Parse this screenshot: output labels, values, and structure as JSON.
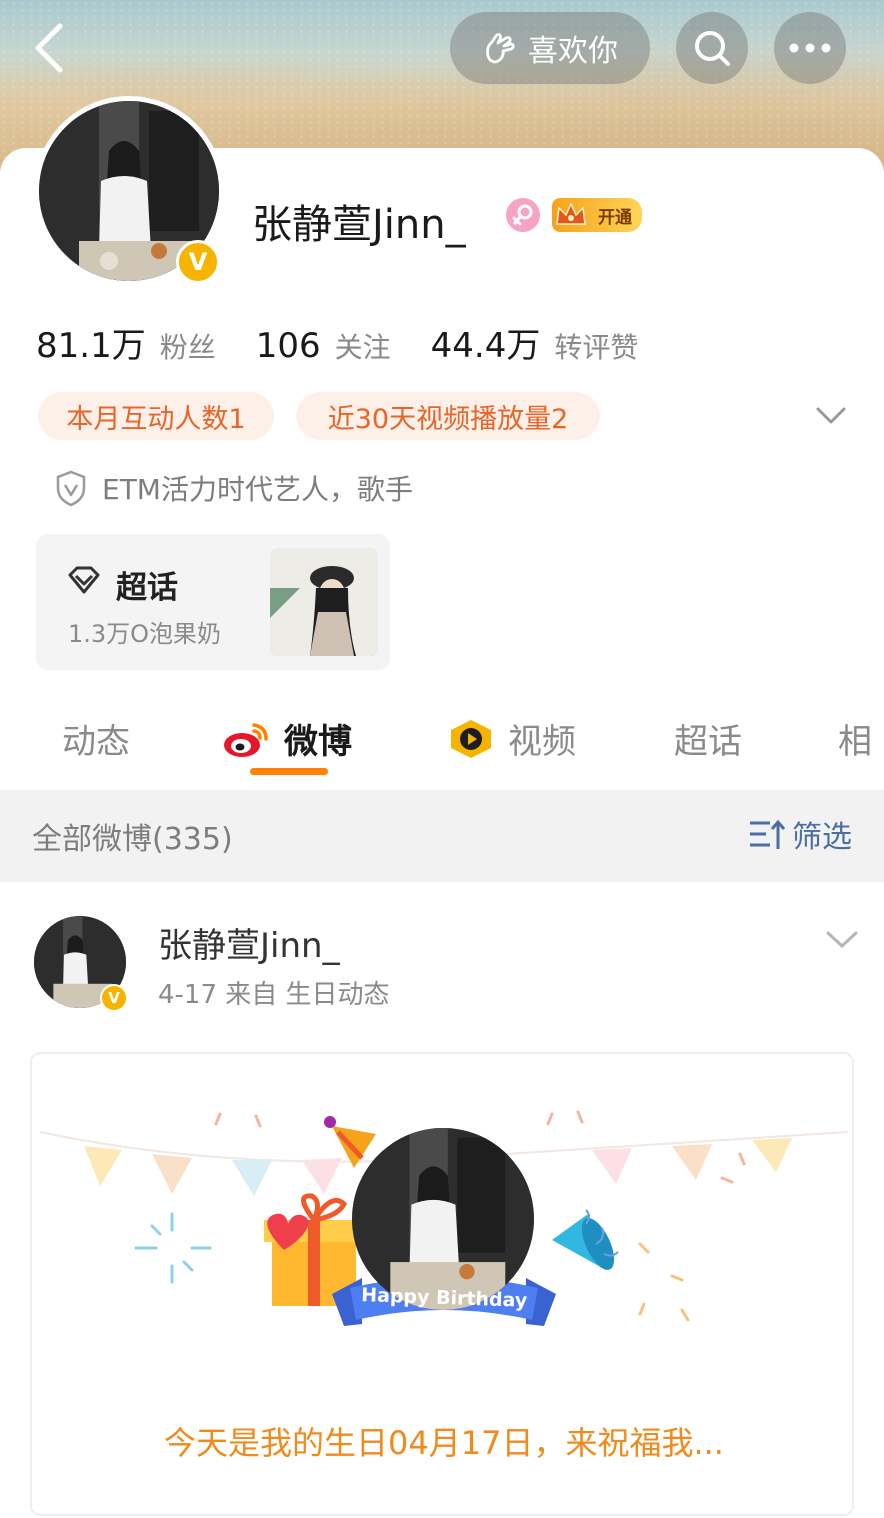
{
  "header": {
    "like_label": "喜欢你"
  },
  "profile": {
    "name": "张静萱Jinn_",
    "vip_label": "开通",
    "stats": [
      {
        "value": "81.1万",
        "label": "粉丝"
      },
      {
        "value": "106",
        "label": "关注"
      },
      {
        "value": "44.4万",
        "label": "转评赞"
      }
    ],
    "tags": [
      "本月互动人数1",
      "近30天视频播放量2"
    ],
    "certification": "ETM活力时代艺人，歌手",
    "chaohua": {
      "title": "超话",
      "subtitle": "1.3万O泡果奶"
    }
  },
  "tabs": [
    {
      "label": "动态"
    },
    {
      "label": "微博"
    },
    {
      "label": "视频"
    },
    {
      "label": "超话"
    },
    {
      "label": "相"
    }
  ],
  "filter": {
    "title": "全部微博(335)",
    "button": "筛选"
  },
  "post": {
    "author": "张静萱Jinn_",
    "meta": "4-17   来自 生日动态",
    "banner_label": "Happy Birthday",
    "text": "今天是我的生日04月17日，来祝福我..."
  },
  "colors": {
    "accent": "#ff8200",
    "tag_text": "#e8652a",
    "tag_bg": "#fdf0e8",
    "verified": "#f6b400",
    "birthday_text": "#f08a1b"
  }
}
